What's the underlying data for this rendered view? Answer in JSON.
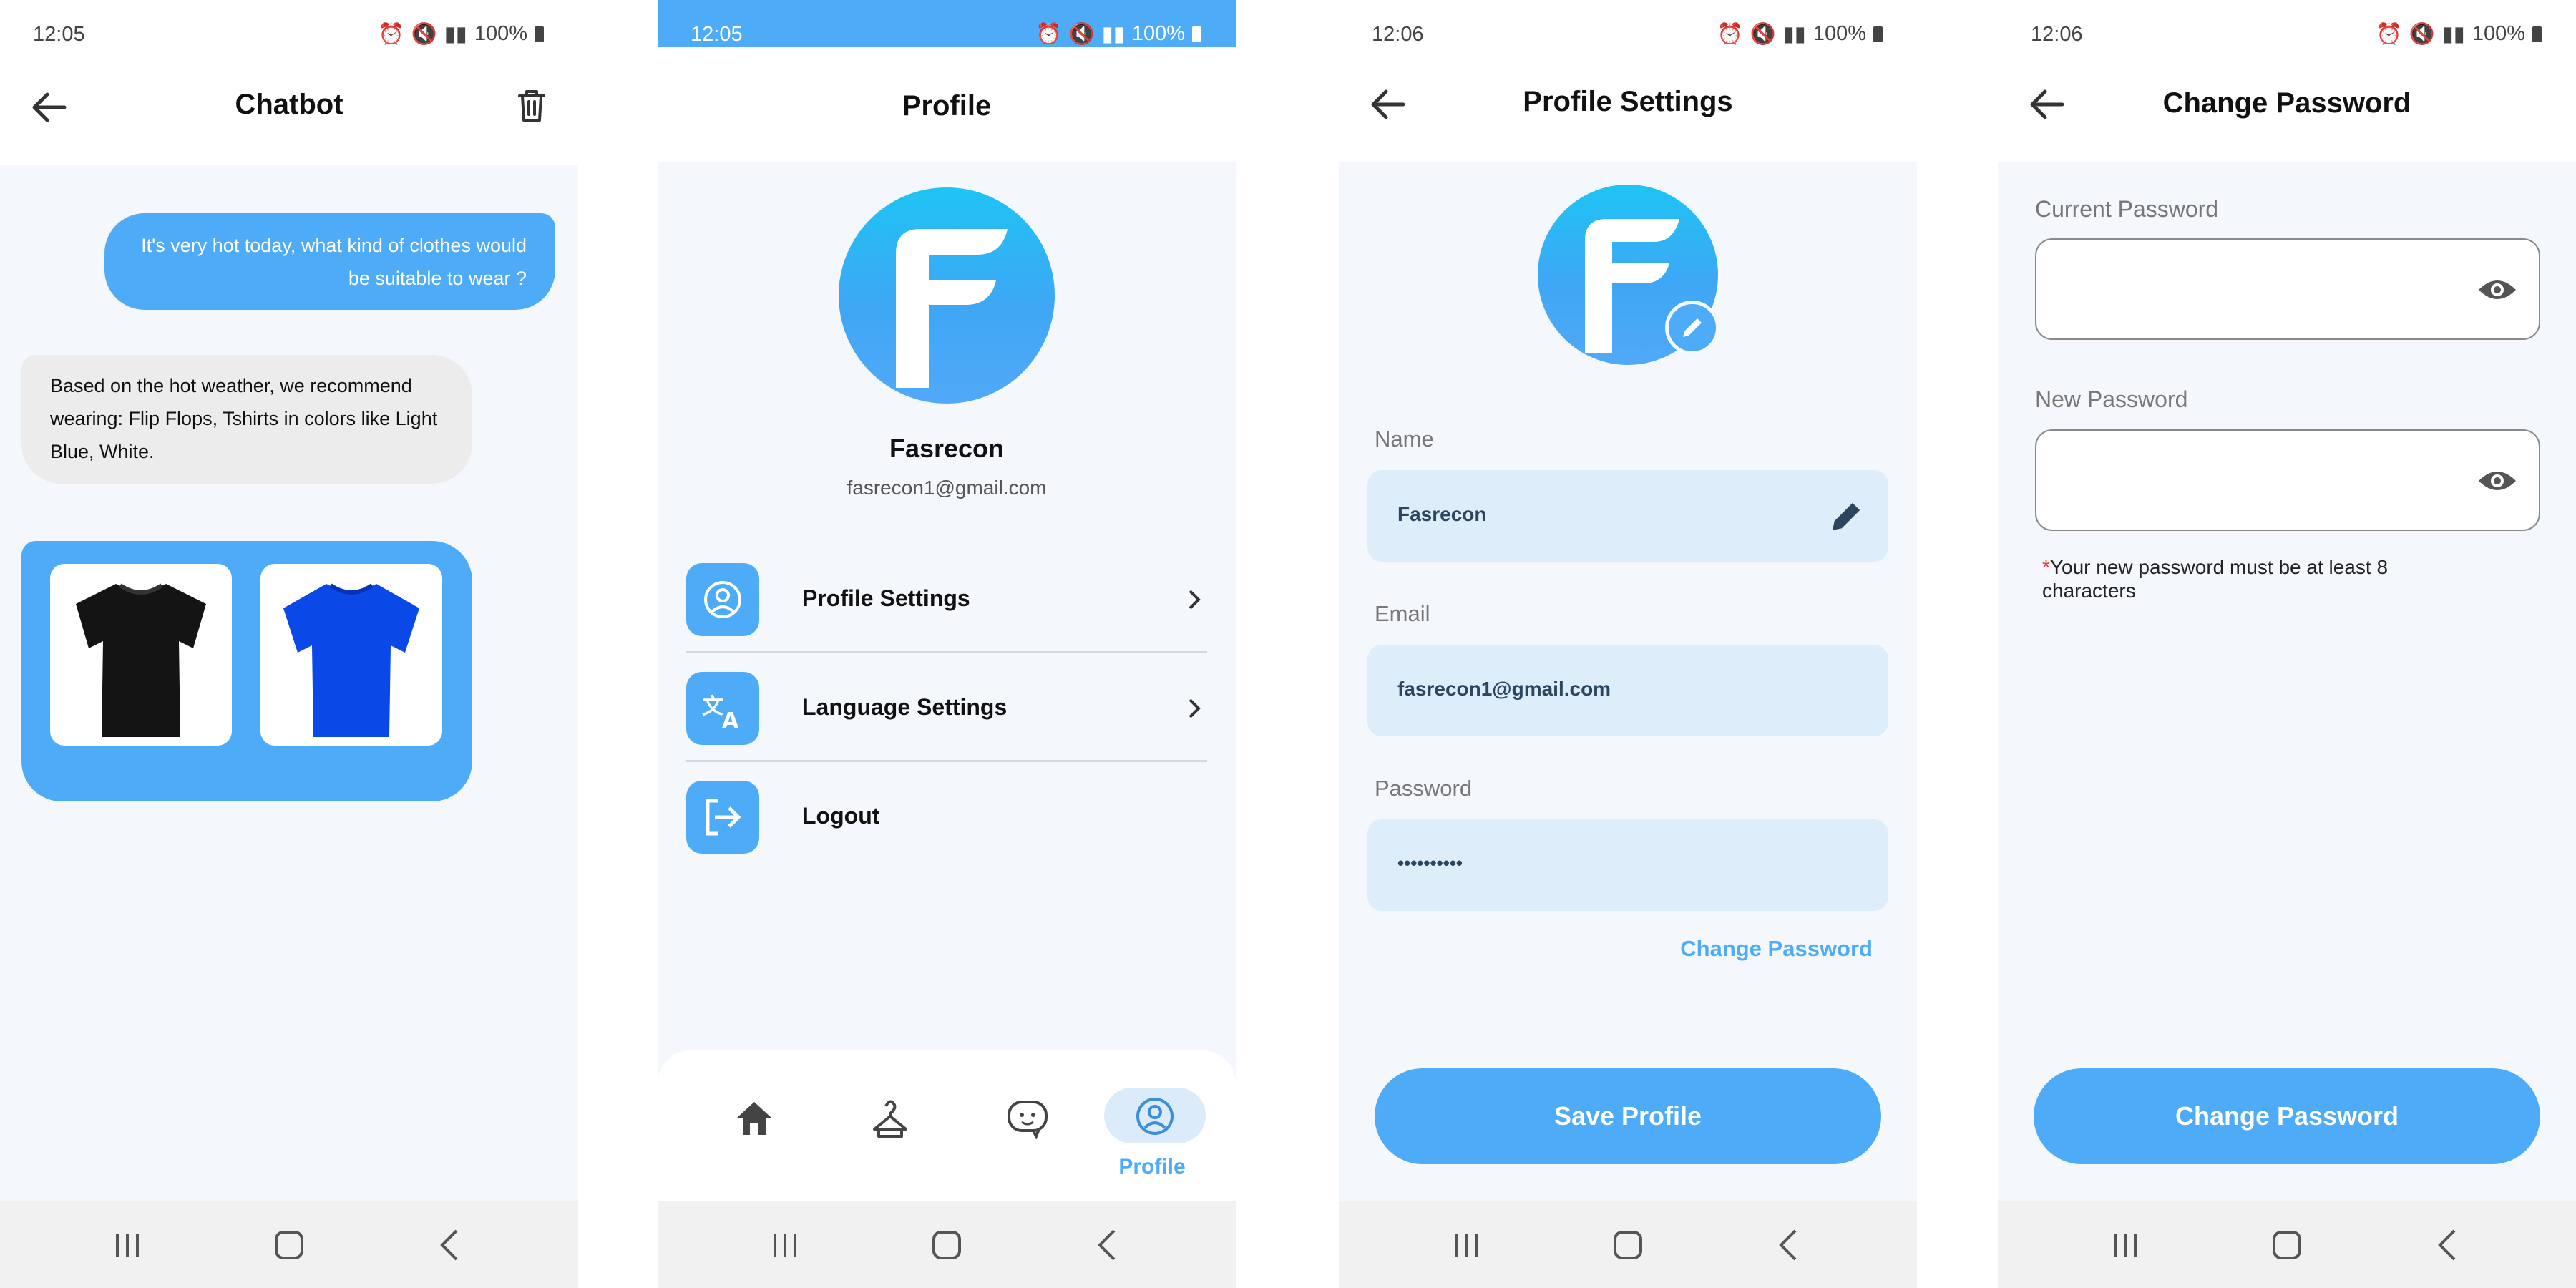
{
  "chatbot": {
    "status": {
      "time": "12:05",
      "battery": "100%"
    },
    "title": "Chatbot",
    "user_message": "It's very hot today, what kind of clothes would be suitable to wear ?",
    "bot_message": "Based on the hot weather, we recommend wearing: Flip Flops, Tshirts in colors like Light Blue, White.",
    "images": [
      {
        "icon": "black-tshirt-image",
        "color": "#141414"
      },
      {
        "icon": "blue-tshirt-image",
        "color": "#0a48e8"
      }
    ]
  },
  "profile": {
    "status": {
      "time": "12:05",
      "battery": "100%"
    },
    "title": "Profile",
    "name": "Fasrecon",
    "email": "fasrecon1@gmail.com",
    "menu": [
      {
        "label": "Profile Settings",
        "icon": "user-circle-icon"
      },
      {
        "label": "Language Settings",
        "icon": "translate-icon"
      },
      {
        "label": "Logout",
        "icon": "logout-icon"
      }
    ],
    "tabs": [
      {
        "icon": "home-icon"
      },
      {
        "icon": "hanger-icon"
      },
      {
        "icon": "chatbot-icon"
      },
      {
        "icon": "profile-icon",
        "label": "Profile",
        "active": true
      }
    ]
  },
  "settings": {
    "status": {
      "time": "12:06",
      "battery": "100%"
    },
    "title": "Profile Settings",
    "name_label": "Name",
    "name_value": "Fasrecon",
    "email_label": "Email",
    "email_value": "fasrecon1@gmail.com",
    "password_label": "Password",
    "password_value": "••••••••••",
    "change_password_link": "Change Password",
    "save_button": "Save Profile"
  },
  "change_password": {
    "status": {
      "time": "12:06",
      "battery": "100%"
    },
    "title": "Change Password",
    "current_label": "Current Password",
    "new_label": "New Password",
    "hint_star": "*",
    "hint": "Your new password must be at least 8 characters",
    "button": "Change Password"
  },
  "colors": {
    "accent": "#4eabf7",
    "field_bg": "#deedfa",
    "screen_bg": "#f4f8fd"
  }
}
